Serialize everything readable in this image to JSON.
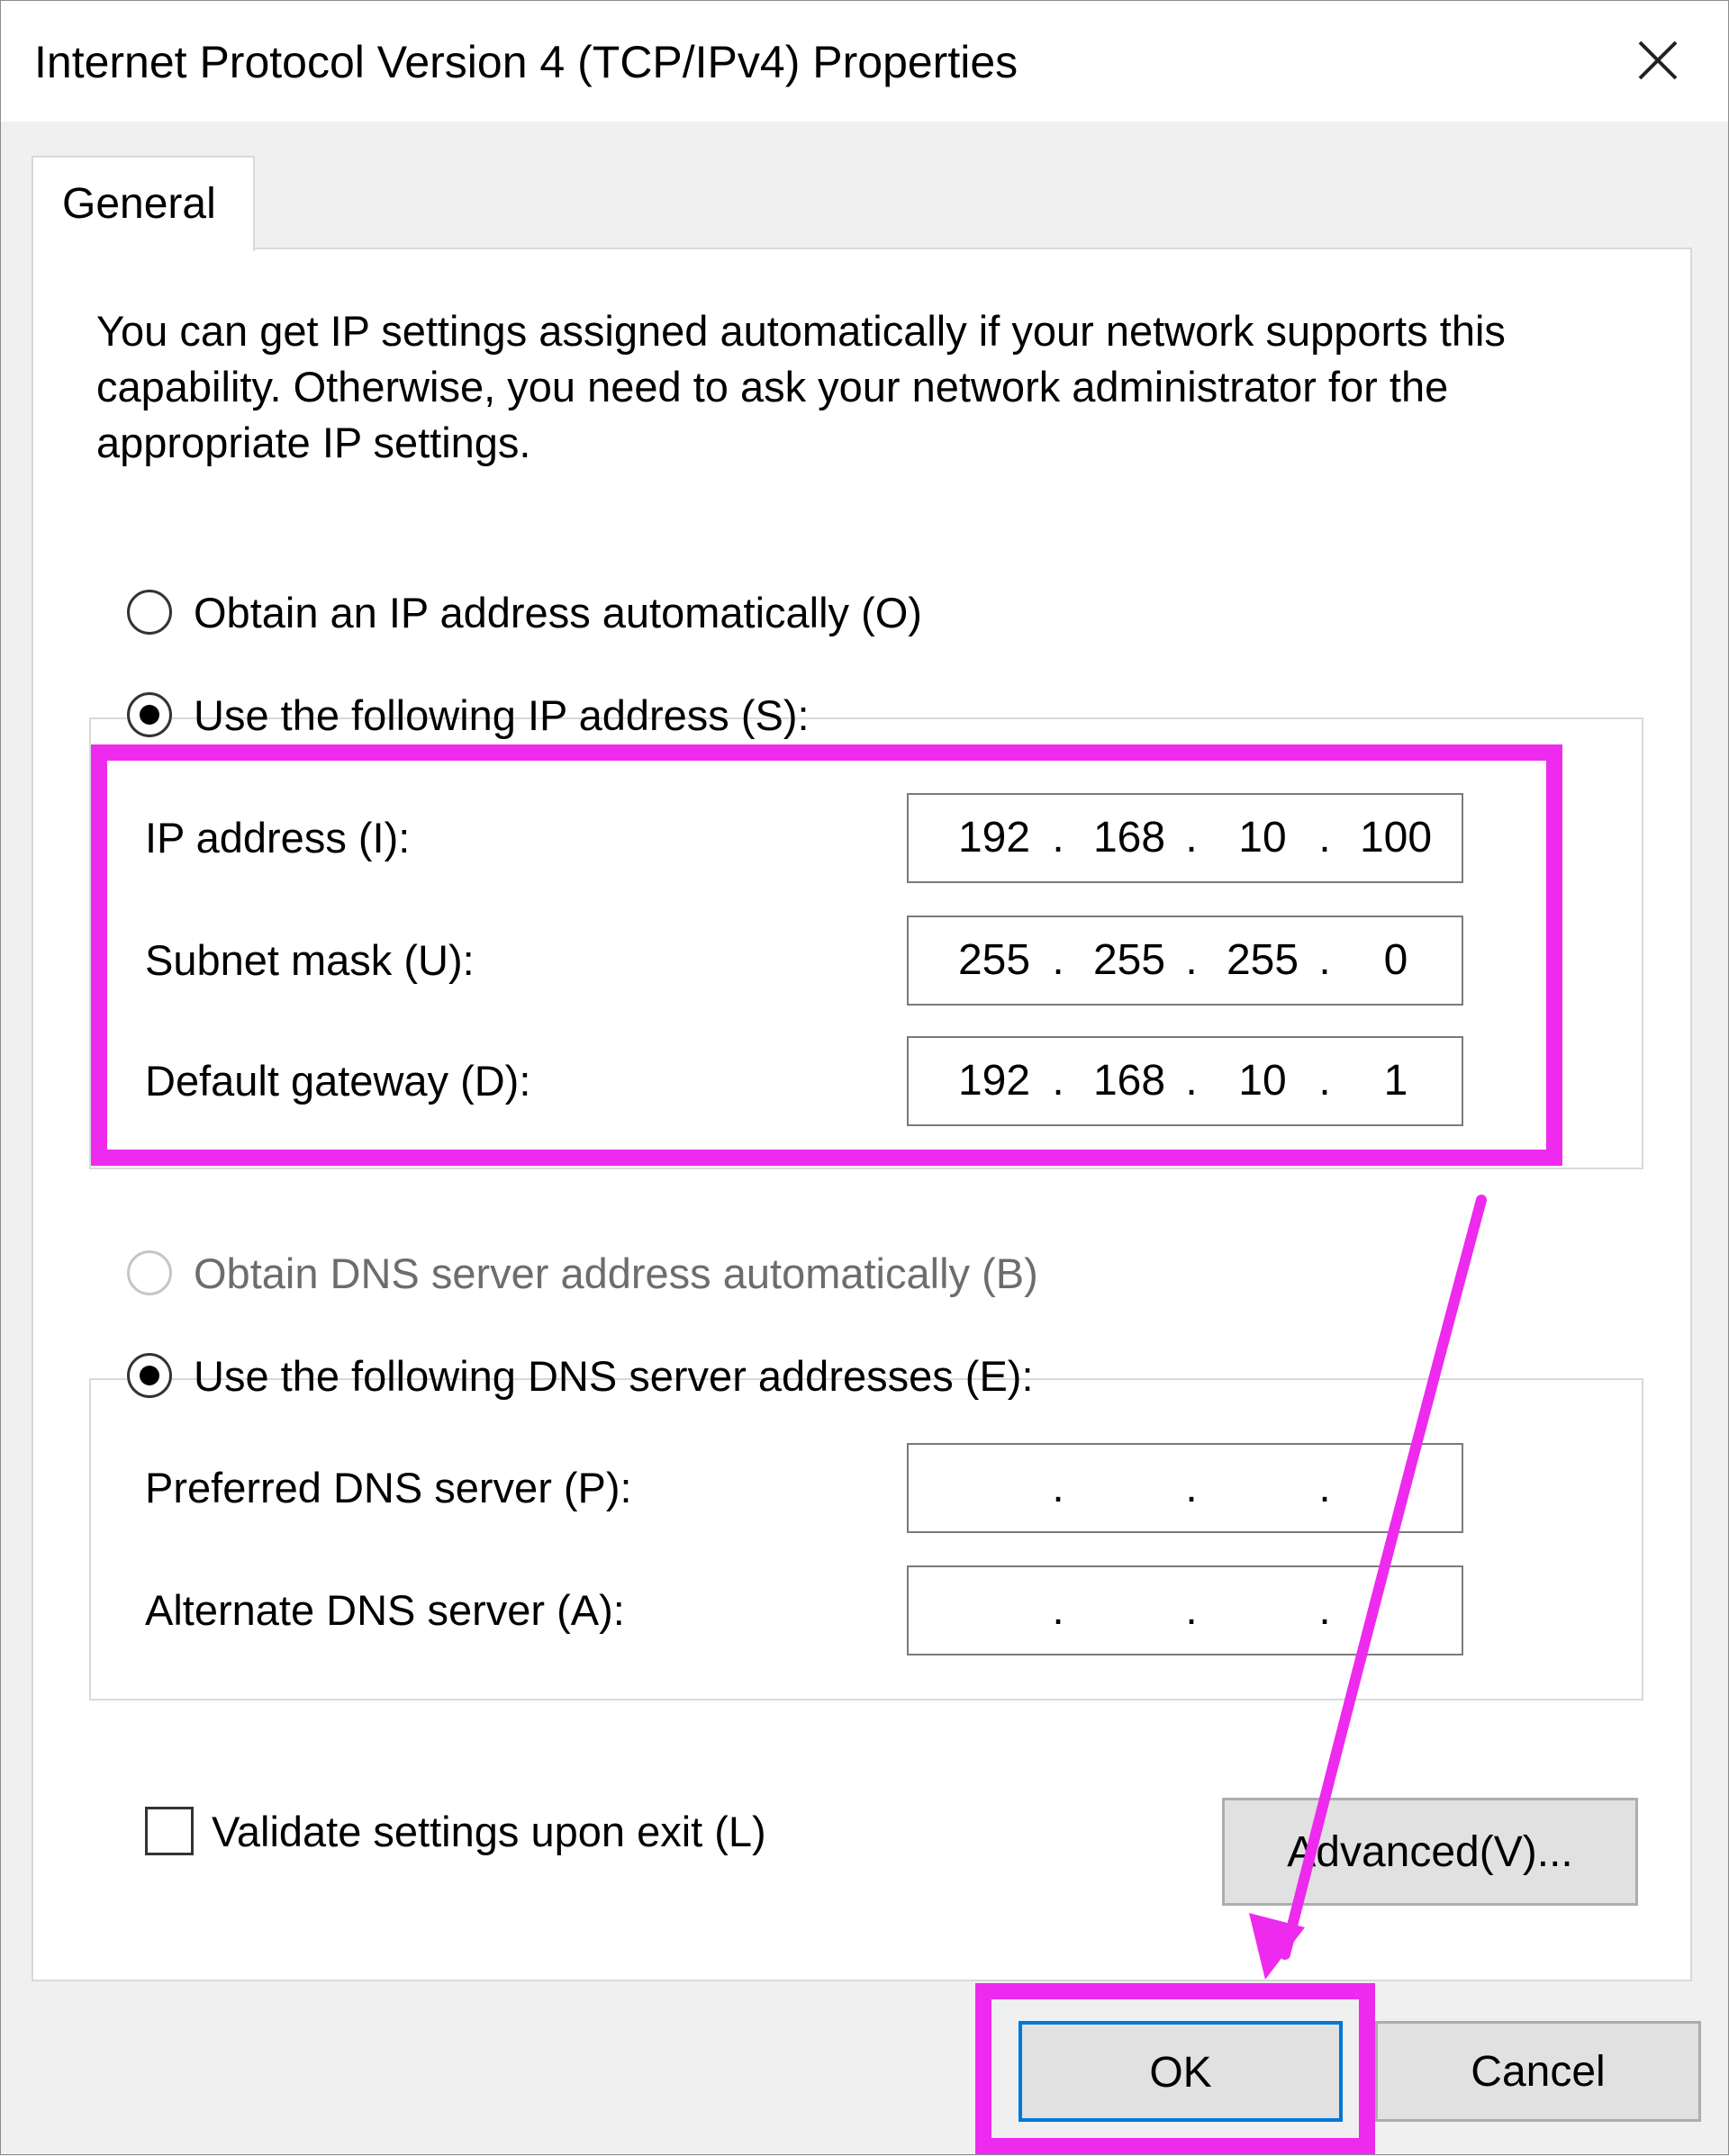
{
  "window": {
    "title": "Internet Protocol Version 4 (TCP/IPv4) Properties",
    "close_icon": "close-icon"
  },
  "tabs": [
    {
      "label": "General",
      "selected": true
    }
  ],
  "intro_text": "You can get IP settings assigned automatically if your network supports this capability. Otherwise, you need to ask your network administrator for the appropriate IP settings.",
  "ip_section": {
    "auto_label": "Obtain an IP address automatically (O)",
    "auto_selected": false,
    "manual_label": "Use the following IP address (S):",
    "manual_selected": true,
    "fields": [
      {
        "label": "IP address (I):",
        "octets": [
          "192",
          "168",
          "10",
          "100"
        ]
      },
      {
        "label": "Subnet mask (U):",
        "octets": [
          "255",
          "255",
          "255",
          "0"
        ]
      },
      {
        "label": "Default gateway (D):",
        "octets": [
          "192",
          "168",
          "10",
          "1"
        ]
      }
    ]
  },
  "dns_section": {
    "auto_label": "Obtain DNS server address automatically (B)",
    "auto_selected": false,
    "auto_disabled": true,
    "manual_label": "Use the following DNS server addresses (E):",
    "manual_selected": true,
    "fields": [
      {
        "label": "Preferred DNS server (P):",
        "octets": [
          "",
          "",
          "",
          ""
        ]
      },
      {
        "label": "Alternate DNS server (A):",
        "octets": [
          "",
          "",
          "",
          ""
        ]
      }
    ]
  },
  "separator": ".",
  "validate": {
    "label": "Validate settings upon exit (L)",
    "checked": false
  },
  "buttons": {
    "advanced_label": "Advanced(V)...",
    "ok_label": "OK",
    "cancel_label": "Cancel"
  },
  "colors": {
    "highlight": "#ee2aee",
    "focus_border": "#0078d7"
  }
}
